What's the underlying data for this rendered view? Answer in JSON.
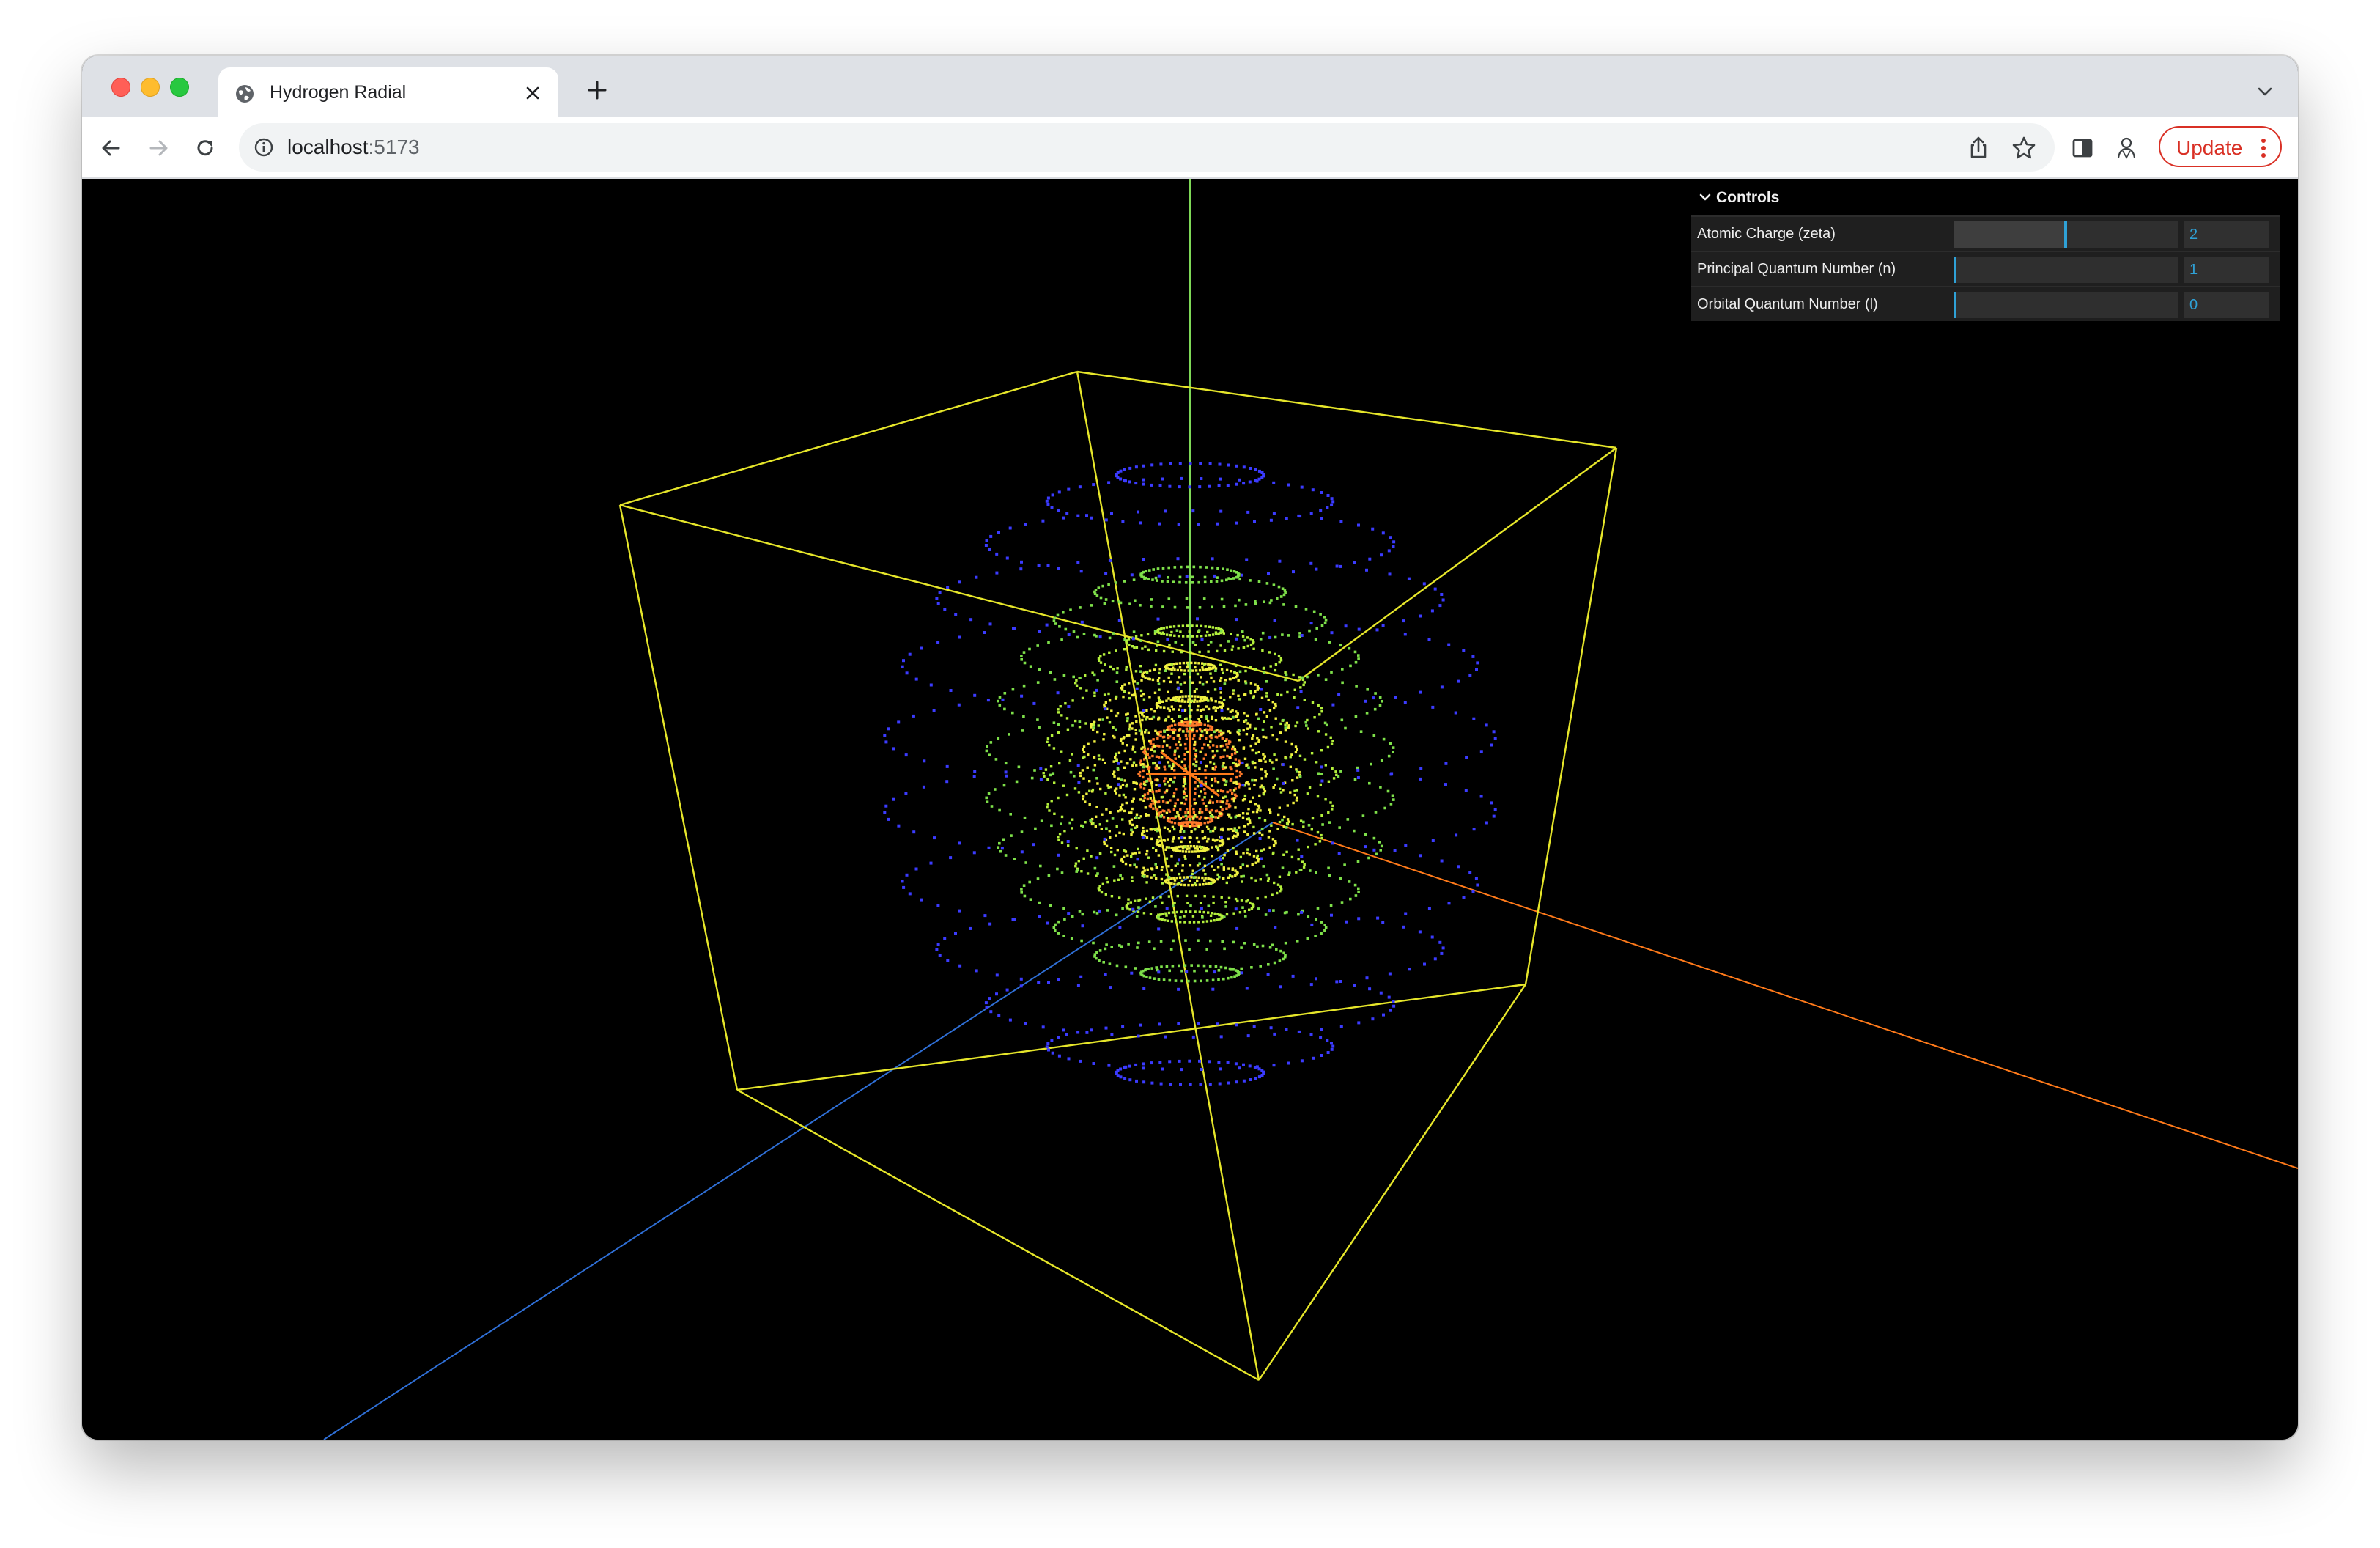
{
  "browser": {
    "tab_title": "Hydrogen Radial",
    "url_host": "localhost",
    "url_port": ":5173",
    "update_label": "Update",
    "colors": {
      "update_accent": "#d93025",
      "tabbar": "#dee1e6"
    }
  },
  "controls": {
    "title": "Controls",
    "rows": [
      {
        "label": "Atomic Charge (zeta)",
        "value": "2",
        "fraction": 0.5
      },
      {
        "label": "Principal Quantum Number (n)",
        "value": "1",
        "fraction": 0.0
      },
      {
        "label": "Orbital Quantum Number (l)",
        "value": "0",
        "fraction": 0.0
      }
    ],
    "accent": "#2fa1d6"
  },
  "scene": {
    "background": "#000000",
    "box_color": "#e6e62a",
    "axis_colors": {
      "x": "#ff7a1a",
      "y": "#7ed957",
      "z": "#2f6fd6"
    },
    "shell_colors": [
      "#ff7a2a",
      "#f0f040",
      "#b4f03c",
      "#7ee04a",
      "#3b3bff"
    ]
  }
}
